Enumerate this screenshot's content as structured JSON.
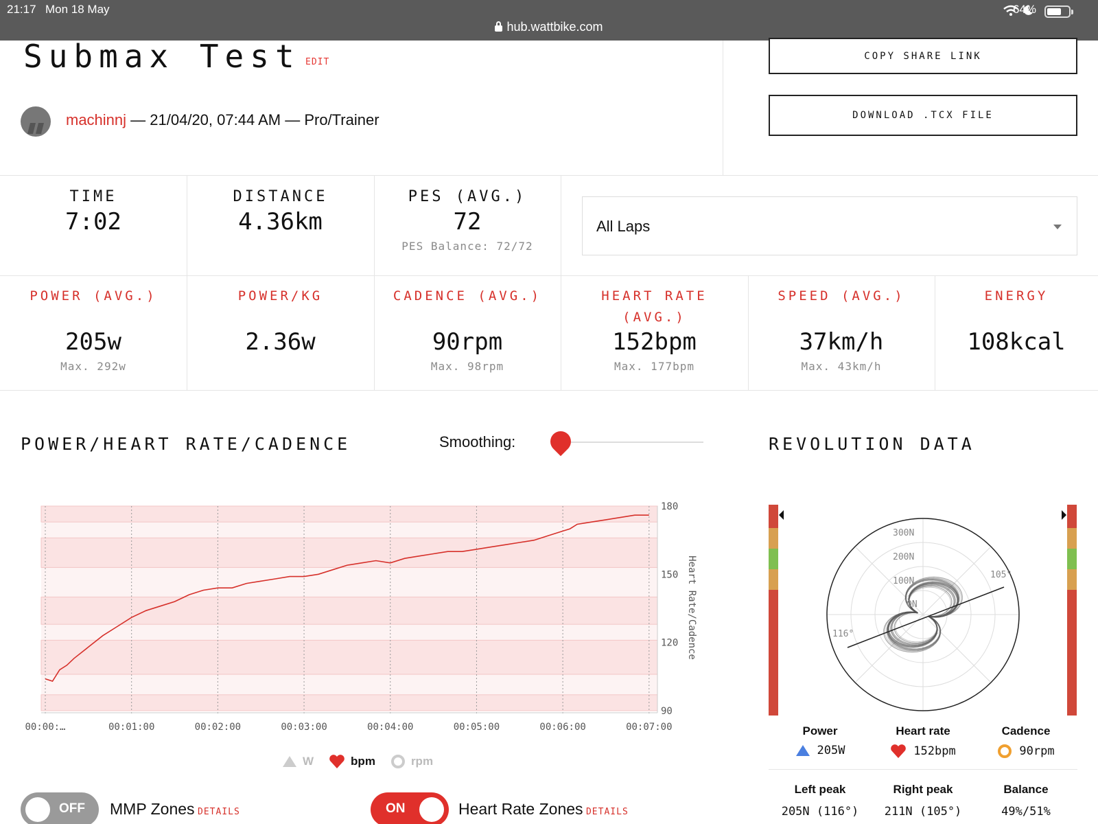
{
  "status_bar": {
    "time": "21:17",
    "date": "Mon 18 May",
    "url": "hub.wattbike.com",
    "battery": "64%"
  },
  "header": {
    "title": "Submax Test",
    "edit_label": "EDIT",
    "username": "machinnj",
    "meta": "— 21/04/20, 07:44 AM — Pro/Trainer",
    "copy_share_label": "COPY SHARE LINK",
    "download_label": "DOWNLOAD .TCX FILE"
  },
  "summary": {
    "time": {
      "label": "TIME",
      "value": "7:02"
    },
    "distance": {
      "label": "DISTANCE",
      "value": "4.36km"
    },
    "pes": {
      "label": "PES (AVG.)",
      "value": "72",
      "sub": "PES Balance: 72/72"
    },
    "laps_select": "All Laps"
  },
  "metrics": [
    {
      "label": "POWER (AVG.)",
      "value": "205w",
      "sub": "Max. 292w"
    },
    {
      "label": "POWER/KG",
      "value": "2.36w",
      "sub": ""
    },
    {
      "label": "CADENCE (AVG.)",
      "value": "90rpm",
      "sub": "Max. 98rpm"
    },
    {
      "label": "HEART RATE (AVG.)",
      "value": "152bpm",
      "sub": "Max. 177bpm"
    },
    {
      "label": "SPEED (AVG.)",
      "value": "37km/h",
      "sub": "Max. 43km/h"
    },
    {
      "label": "ENERGY",
      "value": "108kcal",
      "sub": ""
    }
  ],
  "chart_section": {
    "title": "POWER/HEART RATE/CADENCE",
    "smoothing_label": "Smoothing:",
    "legend": {
      "w": "W",
      "bpm": "bpm",
      "rpm": "rpm"
    }
  },
  "chart_data": {
    "type": "line",
    "title": "",
    "xlabel": "",
    "ylabel": "Heart Rate/Cadence",
    "x_ticks": [
      "00:00:…",
      "00:01:00",
      "00:02:00",
      "00:03:00",
      "00:04:00",
      "00:05:00",
      "00:06:00",
      "00:07:00"
    ],
    "y_ticks": [
      "180",
      "150",
      "120",
      "90"
    ],
    "ylim": [
      90,
      180
    ],
    "xlim_seconds": [
      0,
      422
    ],
    "series": [
      {
        "name": "bpm",
        "color": "#d6302a",
        "x_seconds": [
          0,
          5,
          10,
          15,
          20,
          30,
          40,
          50,
          60,
          70,
          80,
          90,
          100,
          110,
          120,
          130,
          140,
          150,
          160,
          170,
          180,
          190,
          200,
          210,
          220,
          230,
          240,
          250,
          260,
          270,
          280,
          290,
          300,
          310,
          320,
          330,
          340,
          350,
          360,
          365,
          370,
          380,
          390,
          400,
          410,
          420
        ],
        "values": [
          104,
          103,
          108,
          110,
          113,
          118,
          123,
          127,
          131,
          134,
          136,
          138,
          141,
          143,
          144,
          144,
          146,
          147,
          148,
          149,
          149,
          150,
          152,
          154,
          155,
          156,
          155,
          157,
          158,
          159,
          160,
          160,
          161,
          162,
          163,
          164,
          165,
          167,
          169,
          170,
          172,
          173,
          174,
          175,
          176,
          176
        ]
      }
    ],
    "zone_bands": [
      [
        90,
        97
      ],
      [
        106,
        121
      ],
      [
        128,
        140
      ],
      [
        153,
        166
      ],
      [
        173,
        180
      ]
    ]
  },
  "toggles": [
    {
      "state": "OFF",
      "name": "MMP Zones",
      "details": "DETAILS",
      "color": "#9a9a9a"
    },
    {
      "state": "ON",
      "name": "Heart Rate Zones",
      "details": "DETAILS",
      "color": "#e0302b"
    }
  ],
  "revolution": {
    "title": "REVOLUTION DATA",
    "polar_labels": [
      "300N",
      "200N",
      "100N",
      "0N"
    ],
    "left_angle": "116°",
    "right_angle": "105°",
    "stats": [
      {
        "label": "Power",
        "value": "205W",
        "icon": "triangle-icon",
        "color": "#4a7fe0"
      },
      {
        "label": "Heart rate",
        "value": "152bpm",
        "icon": "heart-icon",
        "color": "#e0302b"
      },
      {
        "label": "Cadence",
        "value": "90rpm",
        "icon": "ring-icon",
        "color": "#f0a030"
      }
    ],
    "peaks": [
      {
        "label": "Left peak",
        "value": "205N (116°)"
      },
      {
        "label": "Right peak",
        "value": "211N (105°)"
      },
      {
        "label": "Balance",
        "value": "49%/51%"
      }
    ]
  }
}
